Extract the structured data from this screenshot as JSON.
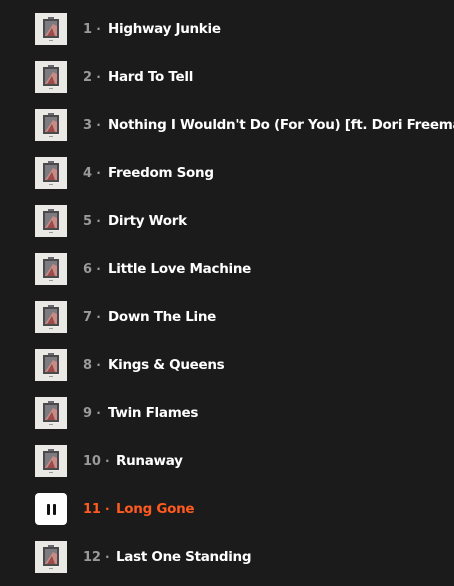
{
  "tracks": [
    {
      "number": "1",
      "title": "Highway Junkie"
    },
    {
      "number": "2",
      "title": "Hard To Tell"
    },
    {
      "number": "3",
      "title": "Nothing I Wouldn't Do (For You) [ft. Dori Freeman]"
    },
    {
      "number": "4",
      "title": "Freedom Song"
    },
    {
      "number": "5",
      "title": "Dirty Work"
    },
    {
      "number": "6",
      "title": "Little Love Machine"
    },
    {
      "number": "7",
      "title": "Down The Line"
    },
    {
      "number": "8",
      "title": "Kings & Queens"
    },
    {
      "number": "9",
      "title": "Twin Flames"
    },
    {
      "number": "10",
      "title": "Runaway"
    },
    {
      "number": "11",
      "title": "Long Gone",
      "state": "playing"
    },
    {
      "number": "12",
      "title": "Last One Standing"
    }
  ],
  "separator": "·",
  "colors": {
    "background": "#1b1b1b",
    "title": "#ffffff",
    "number": "#9a9a9a",
    "active": "#ff5a1f",
    "thumb_bg": "#e9e7e3"
  },
  "icons": {
    "cover": "album-cover-icon",
    "playing": "pause-icon"
  }
}
